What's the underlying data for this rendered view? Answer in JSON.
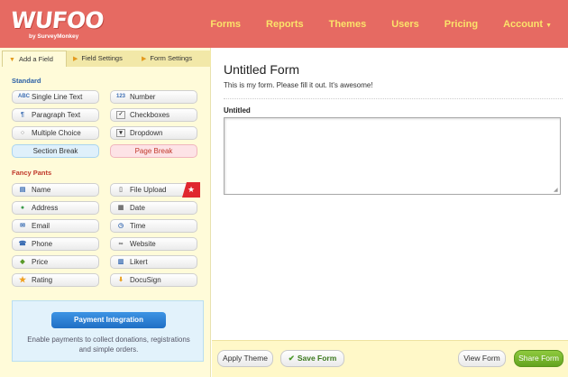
{
  "header": {
    "logo": "WUFOO",
    "tagline": "by SurveyMonkey",
    "nav": [
      {
        "label": "Forms"
      },
      {
        "label": "Reports"
      },
      {
        "label": "Themes"
      },
      {
        "label": "Users"
      },
      {
        "label": "Pricing"
      },
      {
        "label": "Account"
      }
    ]
  },
  "left_panel": {
    "tabs": [
      {
        "label": "Add a Field"
      },
      {
        "label": "Field Settings"
      },
      {
        "label": "Form Settings"
      }
    ],
    "standard_title": "Standard",
    "standard_fields": [
      {
        "label": "Single Line Text",
        "icon": "abc-text-icon",
        "glyph": "ABC"
      },
      {
        "label": "Number",
        "icon": "number-icon",
        "glyph": "123"
      },
      {
        "label": "Paragraph Text",
        "icon": "paragraph-icon",
        "glyph": "¶"
      },
      {
        "label": "Checkboxes",
        "icon": "checkbox-icon",
        "glyph": "✓"
      },
      {
        "label": "Multiple Choice",
        "icon": "radio-icon",
        "glyph": "○"
      },
      {
        "label": "Dropdown",
        "icon": "dropdown-icon",
        "glyph": "▾"
      },
      {
        "label": "Section Break"
      },
      {
        "label": "Page Break"
      }
    ],
    "fancy_title": "Fancy Pants",
    "fancy_fields": [
      {
        "label": "Name",
        "icon": "name-card-icon",
        "glyph": "▤"
      },
      {
        "label": "File Upload",
        "icon": "file-icon",
        "glyph": "▯"
      },
      {
        "label": "Address",
        "icon": "globe-icon",
        "glyph": "●"
      },
      {
        "label": "Date",
        "icon": "calendar-icon",
        "glyph": "▦"
      },
      {
        "label": "Email",
        "icon": "envelope-icon",
        "glyph": "✉"
      },
      {
        "label": "Time",
        "icon": "clock-icon",
        "glyph": "◷"
      },
      {
        "label": "Phone",
        "icon": "phone-icon",
        "glyph": "☎"
      },
      {
        "label": "Website",
        "icon": "link-icon",
        "glyph": "∞"
      },
      {
        "label": "Price",
        "icon": "price-tag-icon",
        "glyph": "◆"
      },
      {
        "label": "Likert",
        "icon": "likert-icon",
        "glyph": "▥"
      },
      {
        "label": "Rating",
        "icon": "star-icon",
        "glyph": "★"
      },
      {
        "label": "DocuSign",
        "icon": "docusign-icon",
        "glyph": "⬇"
      }
    ],
    "payment": {
      "button": "Payment Integration",
      "description": "Enable payments to collect donations, registrations and simple orders."
    }
  },
  "form": {
    "title": "Untitled Form",
    "description": "This is my form. Please fill it out. It's awesome!",
    "field_label": "Untitled"
  },
  "footer": {
    "apply_theme": "Apply Theme",
    "save_form": "Save Form",
    "view_form": "View Form",
    "share_form": "Share Form"
  },
  "colors": {
    "header_bg": "#e66a62",
    "nav_text": "#fbe36a",
    "panel_bg": "#fffbd9",
    "payment_button": "#2a7fd4",
    "share_button": "#6fad2a"
  }
}
